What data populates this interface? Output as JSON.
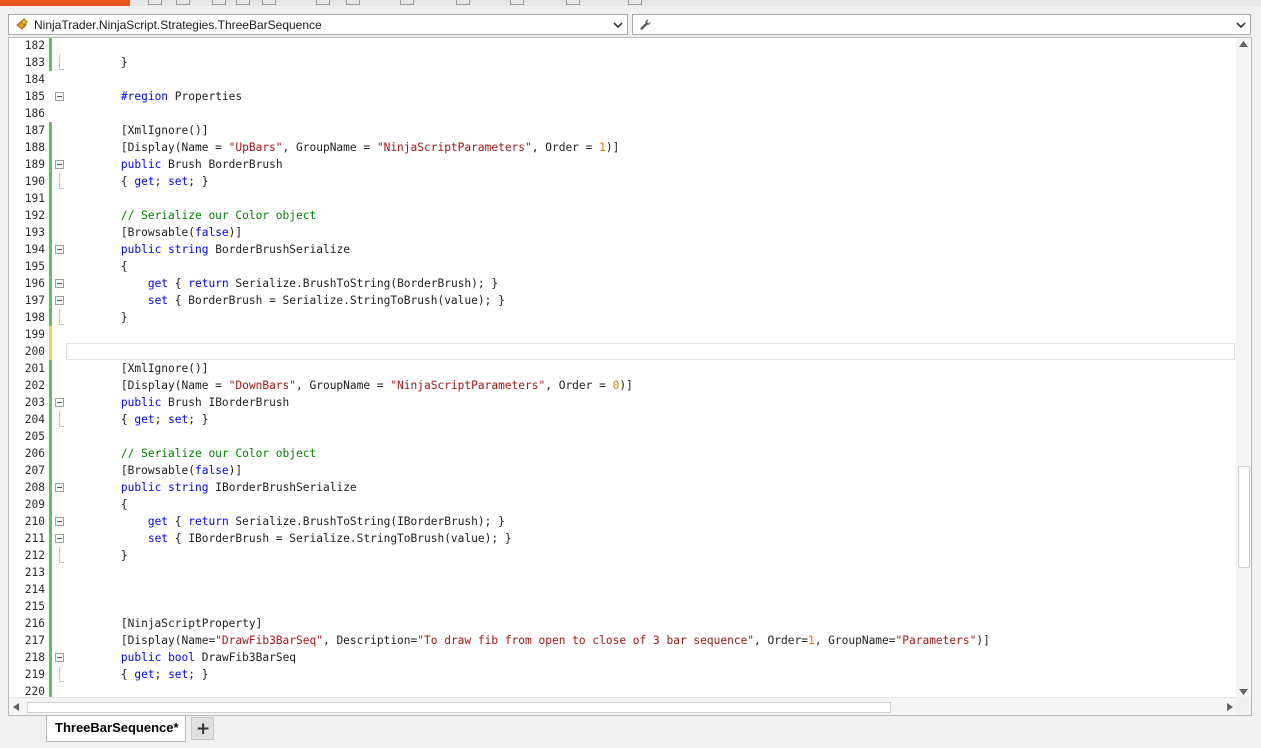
{
  "navigation": {
    "class_selector_value": "NinjaTrader.NinjaScript.Strategies.ThreeBarSequence",
    "member_selector_value": "",
    "class_icon": "class-icon",
    "member_icon": "wrench-icon"
  },
  "editor": {
    "lines": [
      {
        "number": "182",
        "change": "saved",
        "fold": "",
        "tokens": [
          {
            "t": ""
          }
        ]
      },
      {
        "number": "183",
        "change": "saved",
        "fold": "end",
        "tokens": [
          {
            "t": "        }"
          }
        ]
      },
      {
        "number": "184",
        "change": "",
        "fold": "",
        "tokens": [
          {
            "t": ""
          }
        ]
      },
      {
        "number": "185",
        "change": "",
        "fold": "start",
        "tokens": [
          {
            "t": "        "
          },
          {
            "t": "#region",
            "c": "kw"
          },
          {
            "t": " Properties"
          }
        ]
      },
      {
        "number": "186",
        "change": "",
        "fold": "",
        "tokens": [
          {
            "t": ""
          }
        ]
      },
      {
        "number": "187",
        "change": "saved",
        "fold": "",
        "tokens": [
          {
            "t": "        [XmlIgnore()]"
          }
        ]
      },
      {
        "number": "188",
        "change": "saved",
        "fold": "",
        "tokens": [
          {
            "t": "        [Display(Name = "
          },
          {
            "t": "\"UpBars\"",
            "c": "str"
          },
          {
            "t": ", GroupName = "
          },
          {
            "t": "\"NinjaScriptParameters\"",
            "c": "str"
          },
          {
            "t": ", Order = "
          },
          {
            "t": "1",
            "c": "num"
          },
          {
            "t": ")]"
          }
        ]
      },
      {
        "number": "189",
        "change": "saved",
        "fold": "start",
        "tokens": [
          {
            "t": "        "
          },
          {
            "t": "public",
            "c": "kw"
          },
          {
            "t": " Brush BorderBrush"
          }
        ]
      },
      {
        "number": "190",
        "change": "saved",
        "fold": "end",
        "tokens": [
          {
            "t": "        { "
          },
          {
            "t": "get",
            "c": "kw"
          },
          {
            "t": "; "
          },
          {
            "t": "set",
            "c": "kw"
          },
          {
            "t": "; }"
          }
        ]
      },
      {
        "number": "191",
        "change": "saved",
        "fold": "",
        "tokens": [
          {
            "t": ""
          }
        ]
      },
      {
        "number": "192",
        "change": "saved",
        "fold": "",
        "tokens": [
          {
            "t": "        "
          },
          {
            "t": "// Serialize our Color object",
            "c": "cmt"
          }
        ]
      },
      {
        "number": "193",
        "change": "saved",
        "fold": "",
        "tokens": [
          {
            "t": "        [Browsable("
          },
          {
            "t": "false",
            "c": "kw"
          },
          {
            "t": ")]"
          }
        ]
      },
      {
        "number": "194",
        "change": "saved",
        "fold": "start",
        "tokens": [
          {
            "t": "        "
          },
          {
            "t": "public",
            "c": "kw"
          },
          {
            "t": " "
          },
          {
            "t": "string",
            "c": "kw"
          },
          {
            "t": " BorderBrushSerialize"
          }
        ]
      },
      {
        "number": "195",
        "change": "saved",
        "fold": "",
        "tokens": [
          {
            "t": "        {"
          }
        ]
      },
      {
        "number": "196",
        "change": "saved",
        "fold": "start",
        "tokens": [
          {
            "t": "            "
          },
          {
            "t": "get",
            "c": "kw"
          },
          {
            "t": " { "
          },
          {
            "t": "return",
            "c": "kw"
          },
          {
            "t": " Serialize.BrushToString(BorderBrush); }"
          }
        ]
      },
      {
        "number": "197",
        "change": "saved",
        "fold": "start",
        "tokens": [
          {
            "t": "            "
          },
          {
            "t": "set",
            "c": "kw"
          },
          {
            "t": " { BorderBrush = Serialize.StringToBrush(value); }"
          }
        ]
      },
      {
        "number": "198",
        "change": "saved",
        "fold": "end",
        "tokens": [
          {
            "t": "        }"
          }
        ]
      },
      {
        "number": "199",
        "change": "unsaved",
        "fold": "",
        "tokens": [
          {
            "t": ""
          }
        ]
      },
      {
        "number": "200",
        "change": "unsaved",
        "fold": "",
        "tokens": [
          {
            "t": ""
          }
        ]
      },
      {
        "number": "201",
        "change": "saved",
        "fold": "",
        "tokens": [
          {
            "t": "        [XmlIgnore()]"
          }
        ]
      },
      {
        "number": "202",
        "change": "saved",
        "fold": "",
        "tokens": [
          {
            "t": "        [Display(Name = "
          },
          {
            "t": "\"DownBars\"",
            "c": "str"
          },
          {
            "t": ", GroupName = "
          },
          {
            "t": "\"NinjaScriptParameters\"",
            "c": "str"
          },
          {
            "t": ", Order = "
          },
          {
            "t": "0",
            "c": "num"
          },
          {
            "t": ")]"
          }
        ]
      },
      {
        "number": "203",
        "change": "saved",
        "fold": "start",
        "tokens": [
          {
            "t": "        "
          },
          {
            "t": "public",
            "c": "kw"
          },
          {
            "t": " Brush IBorderBrush"
          }
        ]
      },
      {
        "number": "204",
        "change": "saved",
        "fold": "end",
        "tokens": [
          {
            "t": "        { "
          },
          {
            "t": "get",
            "c": "kw"
          },
          {
            "t": "; "
          },
          {
            "t": "set",
            "c": "kw"
          },
          {
            "t": "; }"
          }
        ]
      },
      {
        "number": "205",
        "change": "saved",
        "fold": "",
        "tokens": [
          {
            "t": ""
          }
        ]
      },
      {
        "number": "206",
        "change": "saved",
        "fold": "",
        "tokens": [
          {
            "t": "        "
          },
          {
            "t": "// Serialize our Color object",
            "c": "cmt"
          }
        ]
      },
      {
        "number": "207",
        "change": "saved",
        "fold": "",
        "tokens": [
          {
            "t": "        [Browsable("
          },
          {
            "t": "false",
            "c": "kw"
          },
          {
            "t": ")]"
          }
        ]
      },
      {
        "number": "208",
        "change": "saved",
        "fold": "start",
        "tokens": [
          {
            "t": "        "
          },
          {
            "t": "public",
            "c": "kw"
          },
          {
            "t": " "
          },
          {
            "t": "string",
            "c": "kw"
          },
          {
            "t": " IBorderBrushSerialize"
          }
        ]
      },
      {
        "number": "209",
        "change": "saved",
        "fold": "",
        "tokens": [
          {
            "t": "        {"
          }
        ]
      },
      {
        "number": "210",
        "change": "saved",
        "fold": "start",
        "tokens": [
          {
            "t": "            "
          },
          {
            "t": "get",
            "c": "kw"
          },
          {
            "t": " { "
          },
          {
            "t": "return",
            "c": "kw"
          },
          {
            "t": " Serialize.BrushToString(IBorderBrush); }"
          }
        ]
      },
      {
        "number": "211",
        "change": "saved",
        "fold": "start",
        "tokens": [
          {
            "t": "            "
          },
          {
            "t": "set",
            "c": "kw"
          },
          {
            "t": " { IBorderBrush = Serialize.StringToBrush(value); }"
          }
        ]
      },
      {
        "number": "212",
        "change": "saved",
        "fold": "end",
        "tokens": [
          {
            "t": "        }"
          }
        ]
      },
      {
        "number": "213",
        "change": "saved",
        "fold": "",
        "tokens": [
          {
            "t": ""
          }
        ]
      },
      {
        "number": "214",
        "change": "saved",
        "fold": "",
        "tokens": [
          {
            "t": ""
          }
        ]
      },
      {
        "number": "215",
        "change": "saved",
        "fold": "",
        "tokens": [
          {
            "t": ""
          }
        ]
      },
      {
        "number": "216",
        "change": "saved",
        "fold": "",
        "tokens": [
          {
            "t": "        [NinjaScriptProperty]"
          }
        ]
      },
      {
        "number": "217",
        "change": "saved",
        "fold": "",
        "tokens": [
          {
            "t": "        [Display(Name="
          },
          {
            "t": "\"DrawFib3BarSeq\"",
            "c": "str"
          },
          {
            "t": ", Description="
          },
          {
            "t": "\"To draw fib from open to close of 3 bar sequence\"",
            "c": "str"
          },
          {
            "t": ", Order="
          },
          {
            "t": "1",
            "c": "num"
          },
          {
            "t": ", GroupName="
          },
          {
            "t": "\"Parameters\"",
            "c": "str"
          },
          {
            "t": ")]"
          }
        ]
      },
      {
        "number": "218",
        "change": "saved",
        "fold": "start",
        "tokens": [
          {
            "t": "        "
          },
          {
            "t": "public",
            "c": "kw"
          },
          {
            "t": " "
          },
          {
            "t": "bool",
            "c": "kw"
          },
          {
            "t": " DrawFib3BarSeq"
          }
        ]
      },
      {
        "number": "219",
        "change": "saved",
        "fold": "end",
        "tokens": [
          {
            "t": "        { "
          },
          {
            "t": "get",
            "c": "kw"
          },
          {
            "t": "; "
          },
          {
            "t": "set",
            "c": "kw"
          },
          {
            "t": "; }"
          }
        ]
      },
      {
        "number": "220",
        "change": "saved",
        "fold": "",
        "tokens": [
          {
            "t": ""
          }
        ]
      }
    ]
  },
  "tabs": {
    "active_label": "ThreeBarSequence*",
    "add_label": "+"
  },
  "colors": {
    "keyword": "#0000ff",
    "string": "#a31515",
    "number": "#e07800",
    "comment": "#008000",
    "change_saved": "#5cc25c",
    "change_unsaved": "#f2d84a"
  }
}
